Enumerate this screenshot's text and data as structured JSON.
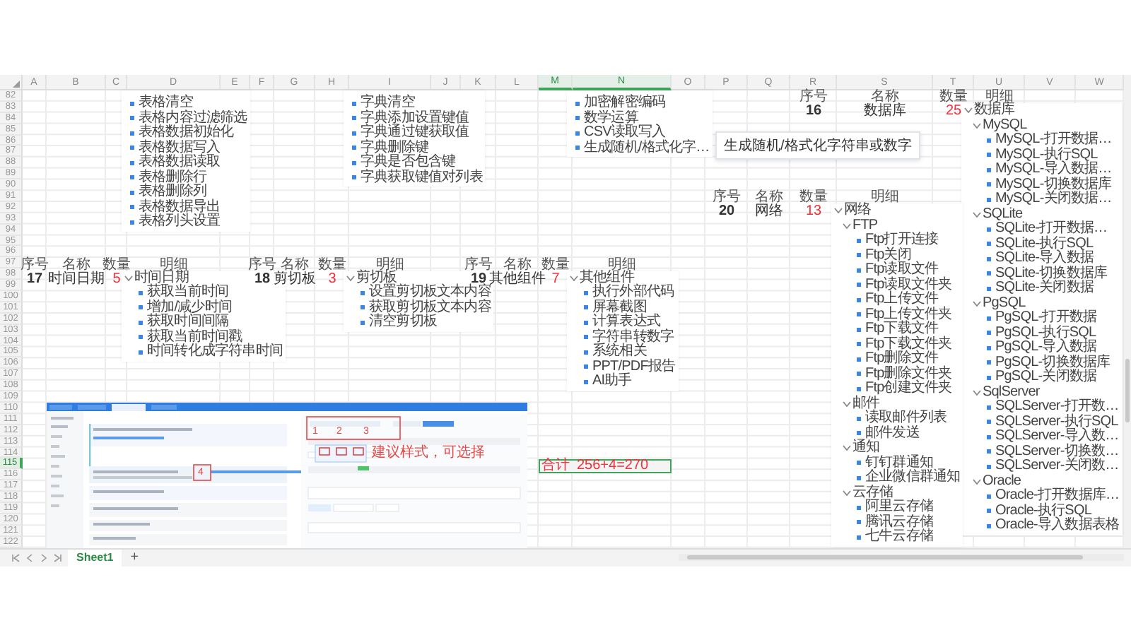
{
  "columns": [
    {
      "label": "A",
      "selected": false
    },
    {
      "label": "B",
      "selected": false
    },
    {
      "label": "C",
      "selected": false
    },
    {
      "label": "D",
      "selected": false
    },
    {
      "label": "E",
      "selected": false
    },
    {
      "label": "F",
      "selected": false
    },
    {
      "label": "G",
      "selected": false
    },
    {
      "label": "H",
      "selected": false
    },
    {
      "label": "I",
      "selected": false
    },
    {
      "label": "J",
      "selected": false
    },
    {
      "label": "K",
      "selected": false
    },
    {
      "label": "L",
      "selected": false
    },
    {
      "label": "M",
      "selected": true
    },
    {
      "label": "N",
      "selected": true
    },
    {
      "label": "O",
      "selected": false
    },
    {
      "label": "P",
      "selected": false
    },
    {
      "label": "Q",
      "selected": false
    },
    {
      "label": "R",
      "selected": false
    },
    {
      "label": "S",
      "selected": false
    },
    {
      "label": "T",
      "selected": false
    },
    {
      "label": "U",
      "selected": false
    },
    {
      "label": "V",
      "selected": false
    },
    {
      "label": "W",
      "selected": false
    }
  ],
  "rows": [
    {
      "label": "82",
      "selected": false
    },
    {
      "label": "83",
      "selected": false
    },
    {
      "label": "84",
      "selected": false
    },
    {
      "label": "85",
      "selected": false
    },
    {
      "label": "86",
      "selected": false
    },
    {
      "label": "87",
      "selected": false
    },
    {
      "label": "88",
      "selected": false
    },
    {
      "label": "89",
      "selected": false
    },
    {
      "label": "90",
      "selected": false
    },
    {
      "label": "91",
      "selected": false
    },
    {
      "label": "92",
      "selected": false
    },
    {
      "label": "93",
      "selected": false
    },
    {
      "label": "94",
      "selected": false
    },
    {
      "label": "95",
      "selected": false
    },
    {
      "label": "96",
      "selected": false
    },
    {
      "label": "97",
      "selected": false
    },
    {
      "label": "98",
      "selected": false
    },
    {
      "label": "99",
      "selected": false
    },
    {
      "label": "100",
      "selected": false
    },
    {
      "label": "101",
      "selected": false
    },
    {
      "label": "102",
      "selected": false
    },
    {
      "label": "103",
      "selected": false
    },
    {
      "label": "104",
      "selected": false
    },
    {
      "label": "105",
      "selected": false
    },
    {
      "label": "106",
      "selected": false
    },
    {
      "label": "107",
      "selected": false
    },
    {
      "label": "108",
      "selected": false
    },
    {
      "label": "109",
      "selected": false
    },
    {
      "label": "110",
      "selected": false
    },
    {
      "label": "111",
      "selected": false
    },
    {
      "label": "112",
      "selected": false
    },
    {
      "label": "113",
      "selected": false
    },
    {
      "label": "114",
      "selected": false
    },
    {
      "label": "115",
      "selected": true
    },
    {
      "label": "116",
      "selected": false
    },
    {
      "label": "117",
      "selected": false
    },
    {
      "label": "118",
      "selected": false
    },
    {
      "label": "119",
      "selected": false
    },
    {
      "label": "120",
      "selected": false
    },
    {
      "label": "121",
      "selected": false
    },
    {
      "label": "122",
      "selected": false
    }
  ],
  "partial_lists": [
    {
      "items": [
        "表格清空",
        "表格内容过滤筛选",
        "表格数据初始化",
        "表格数据写入",
        "表格数据读取",
        "表格删除行",
        "表格删除列",
        "表格数据导出",
        "表格列头设置"
      ]
    },
    {
      "items": [
        "字典清空",
        "字典添加设置键值",
        "字典通过键获取值",
        "字典删除键",
        "字典是否包含键",
        "字典获取键值对列表"
      ]
    },
    {
      "items": [
        "加密解密编码",
        "数学运算",
        "CSV读取写入",
        "生成随机/格式化字…"
      ]
    }
  ],
  "tooltip": "生成随机/格式化字符串或数字",
  "blocks": [
    {
      "headers": [
        "序号",
        "名称",
        "数量",
        "明细"
      ],
      "number": "17",
      "name": "时间日期",
      "count": "5",
      "tree": [
        {
          "label": "时间日期",
          "expanded": true,
          "children": [
            {
              "label": "获取当前时间"
            },
            {
              "label": "增加/减少时间"
            },
            {
              "label": "获取时间间隔"
            },
            {
              "label": "获取当前时间戳"
            },
            {
              "label": "时间转化成字符串时间"
            }
          ]
        }
      ]
    },
    {
      "headers": [
        "序号",
        "名称",
        "数量",
        "明细"
      ],
      "number": "18",
      "name": "剪切板",
      "count": "3",
      "tree": [
        {
          "label": "剪切板",
          "expanded": true,
          "children": [
            {
              "label": "设置剪切板文本内容"
            },
            {
              "label": "获取剪切板文本内容"
            },
            {
              "label": "清空剪切板"
            }
          ]
        }
      ]
    },
    {
      "headers": [
        "序号",
        "名称",
        "数量",
        "明细"
      ],
      "number": "19",
      "name": "其他组件",
      "count": "7",
      "tree": [
        {
          "label": "其他组件",
          "expanded": true,
          "children": [
            {
              "label": "执行外部代码"
            },
            {
              "label": "屏幕截图"
            },
            {
              "label": "计算表达式"
            },
            {
              "label": "字符串转数字"
            },
            {
              "label": "系统相关"
            },
            {
              "label": "PPT/PDF报告"
            },
            {
              "label": "AI助手"
            }
          ]
        }
      ]
    },
    {
      "headers": [
        "序号",
        "名称",
        "数量",
        "明细"
      ],
      "number": "16",
      "name": "数据库",
      "count": "25",
      "tree": [
        {
          "label": "数据库",
          "expanded": true,
          "children": [
            {
              "label": "MySQL",
              "expanded": true,
              "children": [
                {
                  "label": "MySQL-打开数据…"
                },
                {
                  "label": "MySQL-执行SQL"
                },
                {
                  "label": "MySQL-导入数据…"
                },
                {
                  "label": "MySQL-切换数据库"
                },
                {
                  "label": "MySQL-关闭数据…"
                }
              ]
            },
            {
              "label": "SQLite",
              "expanded": true,
              "children": [
                {
                  "label": "SQLite-打开数据…"
                },
                {
                  "label": "SQLite-执行SQL"
                },
                {
                  "label": "SQLite-导入数据"
                },
                {
                  "label": "SQLite-切换数据库"
                },
                {
                  "label": "SQLite-关闭数据"
                }
              ]
            },
            {
              "label": "PgSQL",
              "expanded": true,
              "children": [
                {
                  "label": "PgSQL-打开数据"
                },
                {
                  "label": "PgSQL-执行SQL"
                },
                {
                  "label": "PgSQL-导入数据"
                },
                {
                  "label": "PgSQL-切换数据库"
                },
                {
                  "label": "PgSQL-关闭数据"
                }
              ]
            },
            {
              "label": "SqlServer",
              "expanded": true,
              "children": [
                {
                  "label": "SQLServer-打开数…"
                },
                {
                  "label": "SQLServer-执行SQL"
                },
                {
                  "label": "SQLServer-导入数…"
                },
                {
                  "label": "SQLServer-切换数…"
                },
                {
                  "label": "SQLServer-关闭数…"
                }
              ]
            },
            {
              "label": "Oracle",
              "expanded": true,
              "children": [
                {
                  "label": "Oracle-打开数据库…"
                },
                {
                  "label": "Oracle-执行SQL"
                },
                {
                  "label": "Oracle-导入数据表格"
                }
              ]
            }
          ]
        }
      ]
    },
    {
      "headers": [
        "序号",
        "名称",
        "数量",
        "明细"
      ],
      "number": "20",
      "name": "网络",
      "count": "13",
      "tree": [
        {
          "label": "网络",
          "expanded": true,
          "children": [
            {
              "label": "FTP",
              "expanded": true,
              "children": [
                {
                  "label": "Ftp打开连接"
                },
                {
                  "label": "Ftp关闭"
                },
                {
                  "label": "Ftp读取文件"
                },
                {
                  "label": "Ftp读取文件夹"
                },
                {
                  "label": "Ftp上传文件"
                },
                {
                  "label": "Ftp上传文件夹"
                },
                {
                  "label": "Ftp下载文件"
                },
                {
                  "label": "Ftp下载文件夹"
                },
                {
                  "label": "Ftp删除文件"
                },
                {
                  "label": "Ftp删除文件夹"
                },
                {
                  "label": "Ftp创建文件夹"
                }
              ]
            },
            {
              "label": "邮件",
              "expanded": true,
              "children": [
                {
                  "label": "读取邮件列表"
                },
                {
                  "label": "邮件发送"
                }
              ]
            },
            {
              "label": "通知",
              "expanded": true,
              "children": [
                {
                  "label": "钉钉群通知"
                },
                {
                  "label": "企业微信群通知"
                }
              ]
            },
            {
              "label": "云存储",
              "expanded": true,
              "children": [
                {
                  "label": "阿里云存储"
                },
                {
                  "label": "腾讯云存储"
                },
                {
                  "label": "七牛云存储"
                }
              ]
            }
          ]
        }
      ]
    }
  ],
  "total": {
    "label": "合计",
    "value": "256+4=270"
  },
  "embedded_screenshot": {
    "markers": [
      "1",
      "2",
      "3",
      "4"
    ],
    "note": "建议样式，可选择"
  },
  "sheet_tabs": [
    {
      "label": "Sheet1",
      "selected": true
    }
  ],
  "add_sheet": "+"
}
